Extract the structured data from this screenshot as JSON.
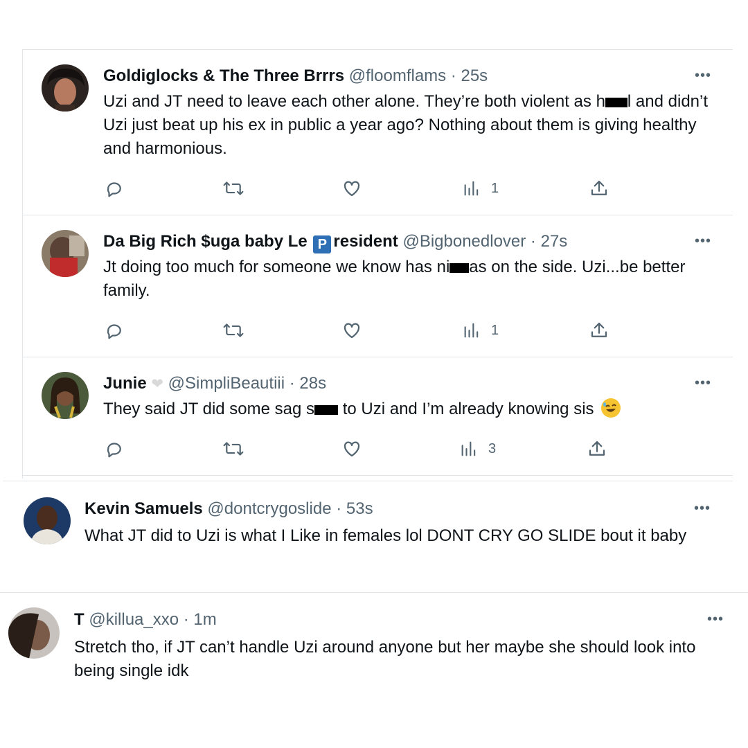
{
  "tweets": [
    {
      "name": "Goldiglocks & The Three Brrrs",
      "handle": "@floomflams",
      "sep": " · ",
      "time": "25s",
      "text_a": "Uzi and JT need to leave each other alone. They’re both violent as h",
      "text_b": "l and didn’t Uzi just beat up his ex in public a year ago? Nothing about them is giving healthy and harmonious.",
      "views": "1"
    },
    {
      "name_a": "Da Big Rich $uga baby Le ",
      "badge": "P",
      "name_b": "resident",
      "handle": "@Bigbonedlover",
      "sep": " · ",
      "time": "27s",
      "text_a": "Jt doing too much for someone we know has ni",
      "text_b": "as on the side. Uzi...be better family.",
      "views": "1"
    },
    {
      "name": "Junie",
      "heart": "🤍",
      "handle": "@SimpliBeautiii",
      "sep": " · ",
      "time": "28s",
      "text_a": "They said JT did some sag s",
      "text_b": " to Uzi and I’m already knowing sis",
      "emoji": "🤣",
      "views": "3"
    },
    {
      "name": "Kevin Samuels",
      "handle": "@dontcrygoslide",
      "sep": " · ",
      "time": "53s",
      "text": "What JT did to Uzi is what I Like in females lol DONT CRY GO SLIDE bout it baby"
    },
    {
      "name": "T",
      "handle": "@killua_xxo",
      "sep": " · ",
      "time": "1m",
      "text": "Stretch tho, if JT can’t handle Uzi around anyone but her maybe she should look into being single idk"
    }
  ],
  "more_label": "•••",
  "icons": [
    "reply-icon",
    "retweet-icon",
    "like-icon",
    "views-icon",
    "share-icon",
    "more-icon"
  ],
  "colors": {
    "text": "#0f1419",
    "secondary": "#536471",
    "divider": "#e3e6e8",
    "president_badge": "#2f6fb5"
  }
}
